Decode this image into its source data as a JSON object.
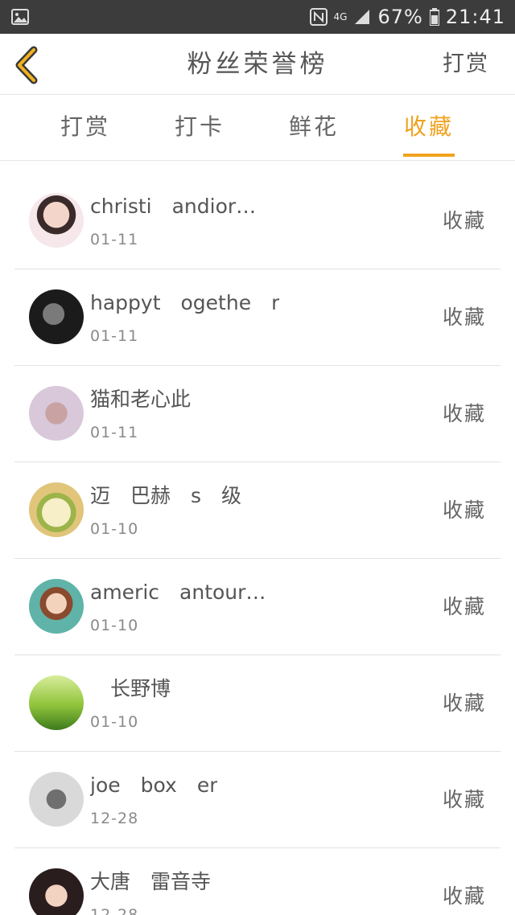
{
  "status_bar": {
    "battery": "67%",
    "time": "21:41",
    "network": "4G",
    "icons": [
      "gallery-icon",
      "nfc-icon",
      "signal-icon",
      "battery-icon"
    ]
  },
  "header": {
    "title": "粉丝荣誉榜",
    "action_label": "打赏",
    "back_icon": "chevron-left-icon"
  },
  "tabs": [
    {
      "label": "打赏",
      "active": false
    },
    {
      "label": "打卡",
      "active": false
    },
    {
      "label": "鲜花",
      "active": false
    },
    {
      "label": "收藏",
      "active": true
    }
  ],
  "colors": {
    "accent": "#f0a21f",
    "status_bar": "#3c3c3c",
    "text": "#555555",
    "divider": "#e2e2e2"
  },
  "list": [
    {
      "name": "christi　andior…",
      "date": "01-11",
      "status": "收藏"
    },
    {
      "name": "happyt　ogethe　r",
      "date": "01-11",
      "status": "收藏"
    },
    {
      "name": "猫和老心此",
      "date": "01-11",
      "status": "收藏"
    },
    {
      "name": "迈　巴赫　s　级",
      "date": "01-10",
      "status": "收藏"
    },
    {
      "name": "americ　antour…",
      "date": "01-10",
      "status": "收藏"
    },
    {
      "name": "　长野博　",
      "date": "01-10",
      "status": "收藏"
    },
    {
      "name": "joe　box　er",
      "date": "12-28",
      "status": "收藏"
    },
    {
      "name": "大唐　雷音寺　",
      "date": "12-28",
      "status": "收藏"
    }
  ]
}
